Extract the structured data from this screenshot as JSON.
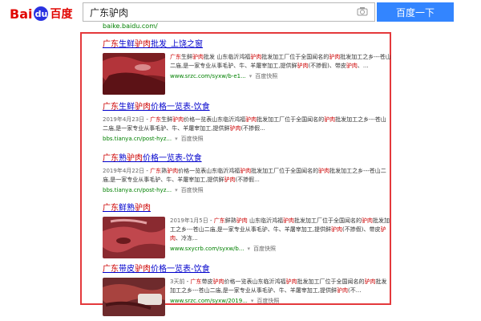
{
  "header": {
    "logo_bai": "Bai",
    "logo_du": "du",
    "logo_cn": "百度",
    "query": "广东驴肉",
    "search_button": "百度一下",
    "above_url": "baike.baidu.com/"
  },
  "results": [
    {
      "title": "广东生鲜驴肉批发_上饶之窗",
      "snippet": "广东生鲜驴肉批发 山东临沂鸿福驴肉批发加工厂位于全国闻名的驴肉批发加工之乡---苍山二庙,是一家专业从事毛驴、牛、羊屠宰加工,提供鲜驴肉(不掺假)、带皮驴肉、...",
      "url": "www.srzc.com/syxw/b-e1...",
      "cache": "百度快照"
    },
    {
      "title": "广东生鲜驴肉价格一览表-饮食",
      "date": "2019年4月23日",
      "snippet": " - 广东生鲜驴肉价格一览表山东临沂鸿福驴肉批发加工厂位于全国闻名的驴肉批发加工之乡---苍山二庙,是一家专业从事毛驴、牛、羊屠宰加工,提供鲜驴肉(不掺假...",
      "url": "bbs.tianya.cn/post-hyz...",
      "cache": "百度快照"
    },
    {
      "title": "广东熟驴肉价格一览表-饮食",
      "date": "2019年4月22日",
      "snippet": " - 广东熟驴肉价格一览表山东临沂鸿福驴肉批发加工厂位于全国闻名的驴肉批发加工之乡---苍山二庙,是一家专业从事毛驴、牛、羊屠宰加工,提供鲜驴肉(不掺假...",
      "url": "bbs.tianya.cn/post-hyz...",
      "cache": "百度快照"
    },
    {
      "title": "广东鲜熟驴肉",
      "date": "2019年1月5日",
      "snippet": " - 广东鲜熟驴肉 山东临沂鸿福驴肉批发加工厂位于全国闻名的驴肉批发加工之乡---苍山二庙,是一家专业从事毛驴、牛、羊屠宰加工,提供鲜驴肉(不掺假)、带皮驴肉、冷冻...",
      "url": "www.sxycrb.com/syxw/b...",
      "cache": "百度快照"
    },
    {
      "title": "广东带皮驴肉价格一览表-饮食",
      "date": "3天前",
      "snippet": " - 广东带皮驴肉价格一览表山东临沂鸿福驴肉批发加工厂位于全国闻名的驴肉批发加工之乡---苍山二庙,是一家专业从事毛驴、牛、羊屠宰加工,提供鲜驴肉(不...",
      "url": "www.srzc.com/syxw/2019...",
      "cache": "百度快照"
    }
  ]
}
